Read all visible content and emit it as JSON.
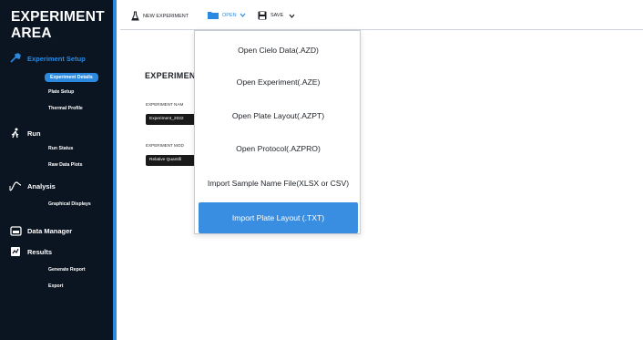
{
  "app": {
    "title_line1": "EXPERIMENT",
    "title_line2": "AREA"
  },
  "sidebar": {
    "sections": [
      {
        "label": "Experiment Setup",
        "icon": "tools-icon",
        "active": true,
        "items": [
          "Experiment Details",
          "Plate Setup",
          "Thermal Profile"
        ]
      },
      {
        "label": "Run",
        "icon": "runner-icon",
        "active": false,
        "items": [
          "Run Status",
          "Raw Data Plots"
        ]
      },
      {
        "label": "Analysis",
        "icon": "analysis-curve-icon",
        "active": false,
        "items": [
          "Graphical Displays"
        ]
      },
      {
        "label": "Data Manager",
        "icon": "data-manager-icon",
        "active": false,
        "items": []
      },
      {
        "label": "Results",
        "icon": "results-icon",
        "active": false,
        "items": [
          "Generate Report",
          "Export"
        ]
      }
    ]
  },
  "toolbar": {
    "new_label": "NEW EXPERIMENT",
    "open_label": "OPEN",
    "save_label": "SAVE"
  },
  "main": {
    "title": "EXPERIMENT",
    "fields": [
      {
        "label": "EXPERIMENT NAM",
        "value": "Experiment_2022"
      },
      {
        "label": "EXPERIMENT MOD",
        "value": "Relative Quantifi"
      }
    ]
  },
  "open_menu": {
    "items": [
      "Open Cielo Data(.AZD)",
      "Open Experiment(.AZE)",
      "Open Plate Layout(.AZPT)",
      "Open Protocol(.AZPRO)",
      "Import Sample Name File(XLSX or CSV)",
      "Import Plate Layout (.TXT)"
    ],
    "highlighted_index": 5
  },
  "colors": {
    "sidebar_bg": "#0b1521",
    "accent": "#2b8ae0",
    "menu_highlight": "#3a8ee2"
  }
}
